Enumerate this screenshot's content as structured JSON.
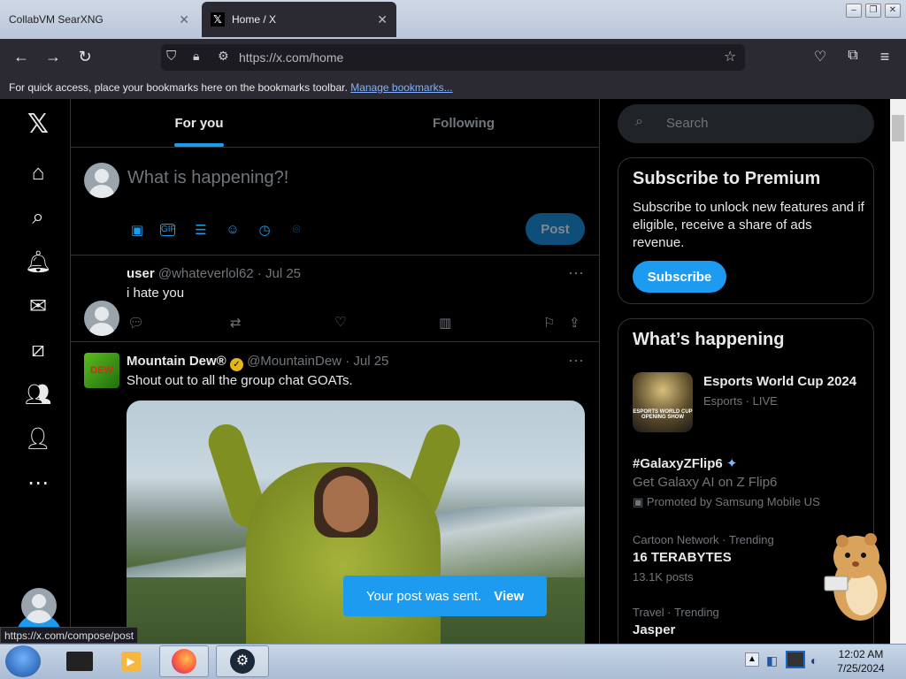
{
  "browser": {
    "tabs": [
      {
        "label": "CollabVM SearXNG"
      },
      {
        "label": "Home / X"
      }
    ],
    "url": "https://x.com/home",
    "bookmarks_message": "For quick access, place your bookmarks here on the bookmarks toolbar.",
    "bookmarks_link": "Manage bookmarks...",
    "status_url": "https://x.com/compose/post"
  },
  "timeline": {
    "tabs": [
      "For you",
      "Following"
    ],
    "compose_placeholder": "What is happening?!",
    "post_label": "Post",
    "tweets": [
      {
        "name": "user",
        "handle": "@whateverlol62",
        "date": "Jul 25",
        "text": "i hate you"
      },
      {
        "name": "Mountain Dew®",
        "handle": "@MountainDew",
        "date": "Jul 25",
        "text": "Shout out to all the group chat GOATs."
      }
    ],
    "toast_text": "Your post was sent.",
    "toast_link": "View"
  },
  "sidebar": {
    "search_placeholder": "Search",
    "premium": {
      "title": "Subscribe to Premium",
      "description": "Subscribe to unlock new features and if eligible, receive a share of ads revenue.",
      "button": "Subscribe"
    },
    "happening": {
      "title": "What’s happening",
      "event": {
        "title": "Esports World Cup 2024",
        "sub": "Esports · LIVE",
        "thumb_text": "ESPORTS WORLD CUP OPENING SHOW"
      },
      "promoted": {
        "tag": "#GalaxyZFlip6",
        "desc": "Get Galaxy AI on Z Flip6",
        "promo": "Promoted by Samsung Mobile US"
      },
      "trends": [
        {
          "category": "Cartoon Network · Trending",
          "title": "16 TERABYTES",
          "count": "13.1K posts"
        },
        {
          "category": "Travel · Trending",
          "title": "Jasper"
        }
      ]
    }
  },
  "taskbar": {
    "time": "12:02 AM",
    "date": "7/25/2024"
  },
  "colors": {
    "accent": "#1d9bf0",
    "background": "#000000",
    "muted": "#71767b"
  }
}
